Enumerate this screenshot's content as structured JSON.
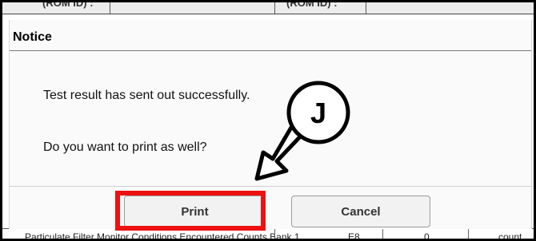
{
  "background": {
    "header_cells": [
      "(ROM ID) :",
      "(ROM ID) :"
    ],
    "footer_cells": [
      "Particulate Filter Monitor Conditions Encountered Counts Bank 1",
      "E8",
      "0",
      "count"
    ]
  },
  "dialog": {
    "title": "Notice",
    "message_line1": "Test result has sent out successfully.",
    "message_line2": "Do you want to print as well?",
    "buttons": {
      "print": "Print",
      "cancel": "Cancel"
    }
  },
  "annotation": {
    "callout_letter": "J",
    "highlight_color": "#ee1111"
  }
}
